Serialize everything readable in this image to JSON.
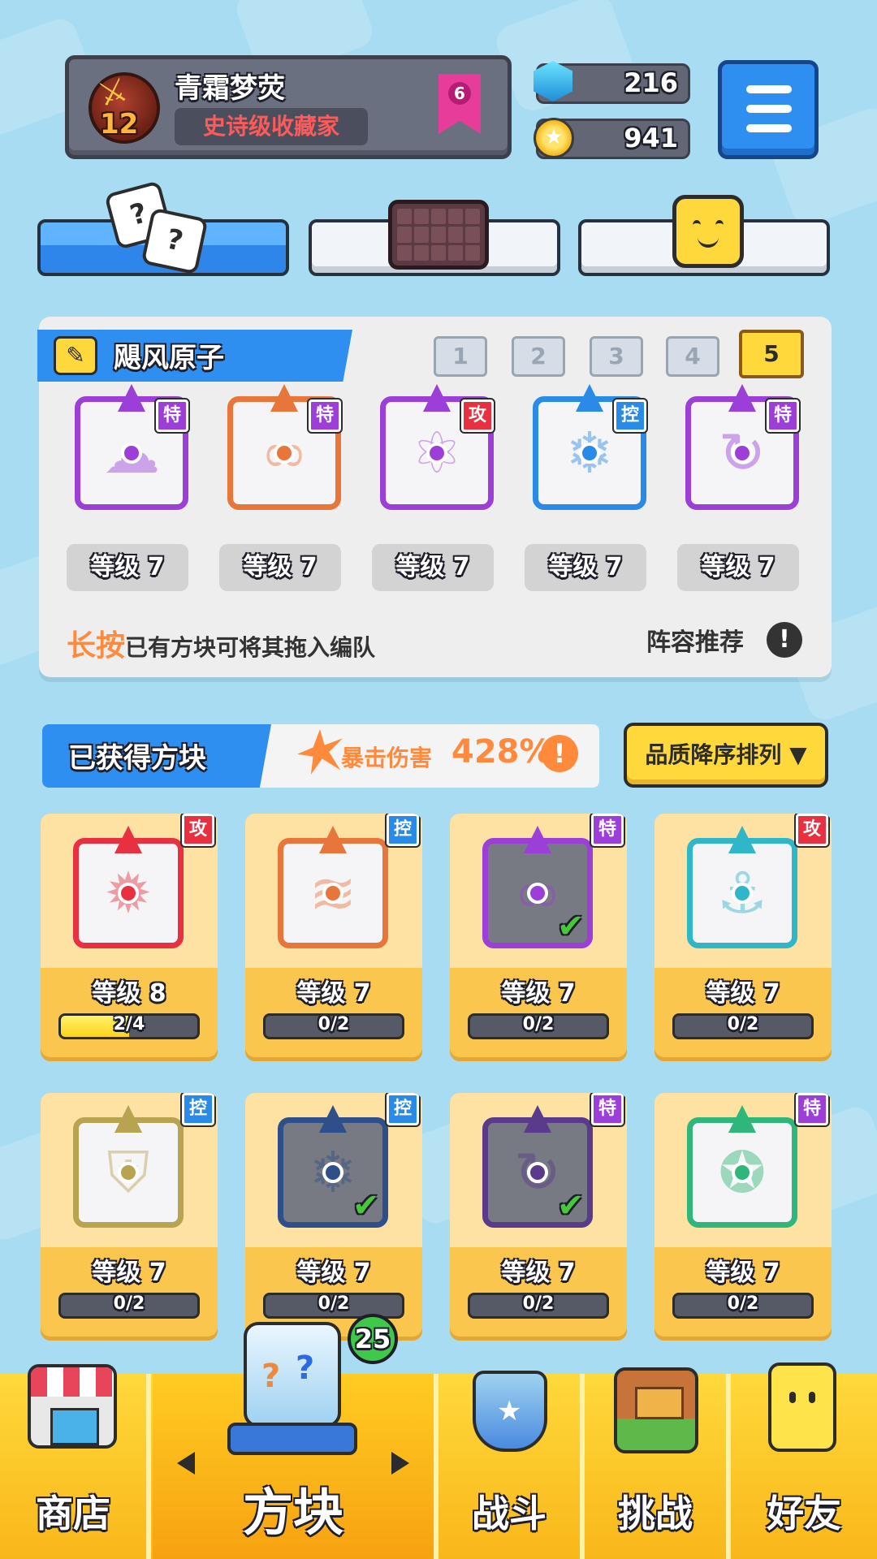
{
  "profile": {
    "level": "12",
    "name": "青霜梦荧",
    "title": "史诗级收藏家",
    "rank": "6"
  },
  "currency": {
    "gems": "216",
    "coins": "941"
  },
  "colors": {
    "accent": "#2f8ff0",
    "gold": "#ffd93b",
    "crit": "#ff8a3c",
    "attack": "#e83040",
    "control": "#2a8ae8",
    "special": "#9b3fd8"
  },
  "tabs": [
    {
      "name": "dice-tab",
      "icon": "dice-icon",
      "active": true
    },
    {
      "name": "grid-tab",
      "icon": "grid-board-icon",
      "active": false
    },
    {
      "name": "emote-tab",
      "icon": "smiley-face-icon",
      "active": false
    }
  ],
  "deck": {
    "name": "飓风原子",
    "tabs": [
      "1",
      "2",
      "3",
      "4",
      "5"
    ],
    "active_tab": "5",
    "cards": [
      {
        "tag": "特",
        "level": "等级 7",
        "color": "#9b3fd8",
        "symbol": "cloud"
      },
      {
        "tag": "特",
        "level": "等级 7",
        "color": "#e8753a",
        "symbol": "infinity"
      },
      {
        "tag": "攻",
        "level": "等级 7",
        "color": "#9b3fd8",
        "symbol": "atom"
      },
      {
        "tag": "控",
        "level": "等级 7",
        "color": "#2a8ae8",
        "symbol": "snowflake"
      },
      {
        "tag": "特",
        "level": "等级 7",
        "color": "#9b3fd8",
        "symbol": "cycle"
      }
    ],
    "hint_highlight": "长按",
    "hint_text": "已有方块可将其拖入编队",
    "recommend": "阵容推荐",
    "recommend_icon": "!"
  },
  "owned": {
    "title": "已获得方块",
    "crit_label": "暴击伤害",
    "crit_value": "428%",
    "info_icon": "!",
    "sort_label": "品质降序排列 ▼",
    "cards": [
      {
        "tag": "攻",
        "level": "等级 8",
        "progress": "2/4",
        "fraction": 0.5,
        "color": "#e83040",
        "symbol": "sun",
        "in_deck": false
      },
      {
        "tag": "控",
        "level": "等级 7",
        "progress": "0/2",
        "fraction": 0,
        "color": "#e8753a",
        "symbol": "sand",
        "in_deck": false
      },
      {
        "tag": "特",
        "level": "等级 7",
        "progress": "0/2",
        "fraction": 0,
        "color": "#9b3fd8",
        "symbol": "infinity",
        "in_deck": true
      },
      {
        "tag": "攻",
        "level": "等级 7",
        "progress": "0/2",
        "fraction": 0,
        "color": "#2fb6c9",
        "symbol": "anchor",
        "in_deck": false
      },
      {
        "tag": "控",
        "level": "等级 7",
        "progress": "0/2",
        "fraction": 0,
        "color": "#b8a350",
        "symbol": "shield",
        "in_deck": false
      },
      {
        "tag": "控",
        "level": "等级 7",
        "progress": "0/2",
        "fraction": 0,
        "color": "#2f4f8a",
        "symbol": "snowflake",
        "in_deck": true
      },
      {
        "tag": "特",
        "level": "等级 7",
        "progress": "0/2",
        "fraction": 0,
        "color": "#5a3a8a",
        "symbol": "cycle",
        "in_deck": true
      },
      {
        "tag": "特",
        "level": "等级 7",
        "progress": "0/2",
        "fraction": 0,
        "color": "#2fb67a",
        "symbol": "pentagram",
        "in_deck": false
      }
    ]
  },
  "nav": {
    "shop": "商店",
    "blocks": "方块",
    "blocks_badge": "25",
    "battle": "战斗",
    "challenge": "挑战",
    "friends": "好友"
  }
}
